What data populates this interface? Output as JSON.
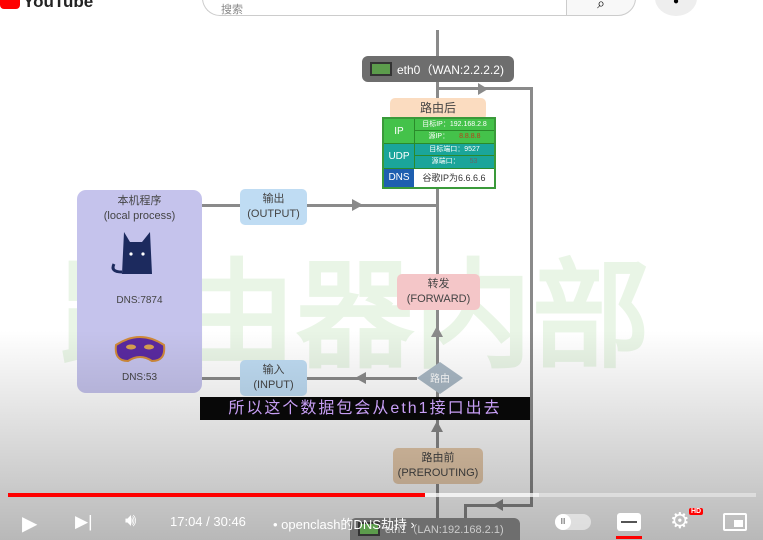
{
  "header": {
    "logo": "YouTube",
    "search_placeholder": "搜索",
    "search_icon": "search-icon",
    "mic_icon": "mic-icon"
  },
  "diagram": {
    "watermark": "路由器内部",
    "eth0": "eth0（WAN:2.2.2.2)",
    "postrouting": "路由后",
    "packet": {
      "ip_label": "IP",
      "dst_ip": "目标IP：192.168.2.8",
      "src_ip_label": "源IP：",
      "src_ip": "8.8.8.8",
      "udp_label": "UDP",
      "dst_port": "目标端口：9527",
      "src_port_label": "源端口：",
      "src_port": "53",
      "dns_label": "DNS",
      "dns_value": "谷歌IP为6.6.6.6"
    },
    "local_title": "本机程序",
    "local_sub": "(local process)",
    "cat_dns": "DNS:7874",
    "mask_dns": "DNS:53",
    "output": {
      "cn": "输出",
      "en": "(OUTPUT)"
    },
    "input": {
      "cn": "输入",
      "en": "(INPUT)"
    },
    "forward": {
      "cn": "转发",
      "en": "(FORWARD)"
    },
    "route": "路由",
    "prerouting": {
      "cn": "路由前",
      "en": "(PREROUTING)"
    },
    "eth1": "eth1（LAN:192.168.2.1)"
  },
  "subtitle": "所以这个数据包会从eth1接口出去",
  "player": {
    "current_time": "17:04",
    "duration": "30:46",
    "time_display": "17:04 / 30:46",
    "chapter": "• openclash的DNS劫持",
    "chapter_arrow": "›",
    "progress_percent": 55.8,
    "buffered_percent": 71,
    "hd_badge": "HD",
    "accent": "#ff0000"
  }
}
